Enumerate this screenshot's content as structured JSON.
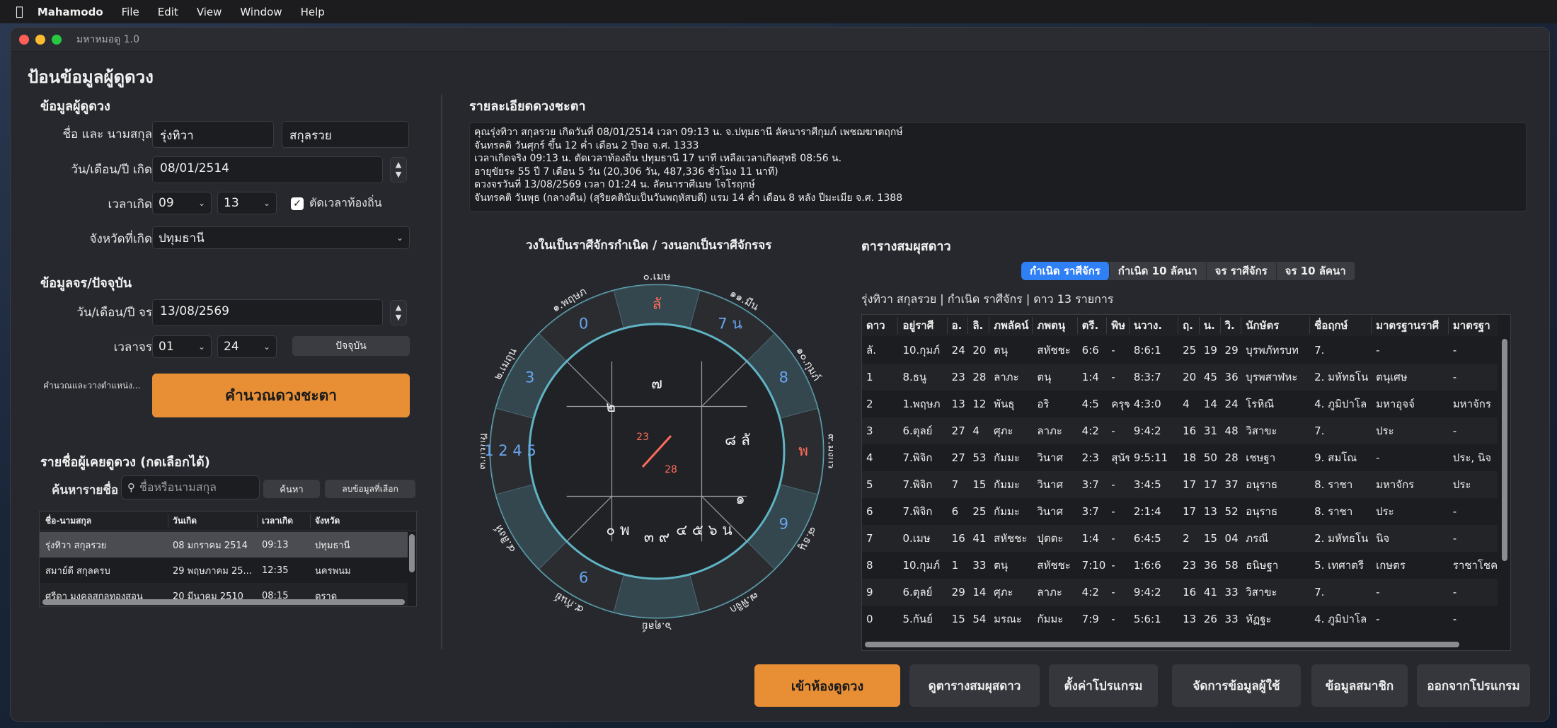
{
  "menubar": {
    "app": "Mahamodo",
    "items": [
      "File",
      "Edit",
      "View",
      "Window",
      "Help"
    ]
  },
  "window_title": "มหาหมอดู 1.0",
  "page_title": "ป้อนข้อมูลผู้ดูดวง",
  "person": {
    "section": "ข้อมูลผู้ดูดวง",
    "name_label": "ชื่อ และ นามสกุล",
    "first_name": "รุ่งทิวา",
    "last_name": "สกุลรวย",
    "dob_label": "วัน/เดือน/ปี เกิด",
    "dob": "08/01/2514",
    "time_label": "เวลาเกิด",
    "hour": "09",
    "minute": "13",
    "local_time_label": "ตัดเวลาท้องถิ่น",
    "province_label": "จังหวัดที่เกิด",
    "province": "ปทุมธานี"
  },
  "transit": {
    "section": "ข้อมูลจร/ปัจจุบัน",
    "date_label": "วัน/เดือน/ปี จร",
    "date": "13/08/2569",
    "time_label": "เวลาจร",
    "hour": "01",
    "minute": "24",
    "now_button": "ปัจจุบัน",
    "calc_status": "คำนวณและวางตำแหน่ง...",
    "calc_button": "คำนวณดวงชะตา"
  },
  "history": {
    "title": "รายชื่อผู้เคยดูดวง (กดเลือกได้)",
    "search_label": "ค้นหารายชื่อ :",
    "search_placeholder": "ชื่อหรือนามสกุล",
    "search_button": "ค้นหา",
    "delete_button": "ลบข้อมูลที่เลือก",
    "columns": [
      "ชื่อ-นามสกุล",
      "วันเกิด",
      "เวลาเกิด",
      "จังหวัด"
    ],
    "rows": [
      [
        "รุ่งทิวา สกุลรวย",
        "08 มกราคม 2514",
        "09:13",
        "ปทุมธานี"
      ],
      [
        "สมาย์ดี สกุลครบ",
        "29 พฤษภาคม 25...",
        "12:35",
        "นครพนม"
      ],
      [
        "ศรีดา มงคลสกุลทองสอน",
        "20 มีนาคม 2510",
        "08:15",
        "ตราด"
      ]
    ]
  },
  "details": {
    "title": "รายละเอียดดวงชะตา",
    "lines": [
      "คุณรุ่งทิวา สกุลรวย เกิดวันที่ 08/01/2514 เวลา 09:13 น. จ.ปทุมธานี ลัคนาราศีกุมภ์ เพชฌฆาตฤกษ์",
      "จันทรคติ วันศุกร์ ขึ้น 12 ค่ำ เดือน 2 ปีจอ จ.ศ. 1333",
      "เวลาเกิดจริง 09:13 น. ตัดเวลาท้องถิ่น ปทุมธานี 17 นาที เหลือเวลาเกิดสุทธิ 08:56 น.",
      "อายุขัยระ 55 ปี 7 เดือน 5 วัน (20,306 วัน, 487,336 ชั่วโมง 11 นาที)",
      "ดวงจรวันที่ 13/08/2569 เวลา 01:24 น. ลัคนาราศีเมษ โจโรฤกษ์",
      "จันทรคติ วันพุธ (กลางคืน) (สุริยคตินับเป็นวันพฤหัสบดี) แรม 14 ค่ำ เดือน 8 หลัง ปีมะเมีย จ.ศ. 1388"
    ]
  },
  "wheel": {
    "title": "วงในเป็นราศีจักรกำเนิด / วงนอกเป็นราศีจักรจร",
    "signs": [
      "๐.เมษ",
      "๑.พฤษภ",
      "๒.เมถุน",
      "๓.กรกฎ",
      "๔.สิงห์",
      "๕.กันย์",
      "๖.ตุลย์",
      "๗.พิจิก",
      "๘.ธนู",
      "๙.มังกร",
      "๑๐.กุมภ์",
      "๑๑.มีน"
    ],
    "outer_marks": [
      {
        "text": "ลั",
        "color": "#ff6b5b"
      },
      {
        "text": "0",
        "color": "#6aa5f0"
      },
      {
        "text": "3",
        "color": "#6aa5f0"
      },
      {
        "text": "1 2 4 5",
        "color": "#6aa5f0"
      },
      {
        "text": "",
        "color": "#6aa5f0"
      },
      {
        "text": "6",
        "color": "#6aa5f0"
      },
      {
        "text": "",
        "color": "#6aa5f0"
      },
      {
        "text": "",
        "color": "#6aa5f0"
      },
      {
        "text": "9",
        "color": "#6aa5f0"
      },
      {
        "text": "พ",
        "color": "#ff6b5b"
      },
      {
        "text": "8",
        "color": "#6aa5f0"
      },
      {
        "text": "7 น",
        "color": "#6aa5f0"
      }
    ],
    "inner_marks": [
      {
        "text": "๗"
      },
      {
        "text": "๒"
      },
      {
        "text": ""
      },
      {
        "text": ""
      },
      {
        "text": "๐ พ"
      },
      {
        "text": "๓ ๙"
      },
      {
        "text": "๔ ๕ ๖ น"
      },
      {
        "text": "๑"
      },
      {
        "text": ""
      },
      {
        "text": "๘ ลั"
      }
    ],
    "center": {
      "a": "23",
      "b": "28"
    }
  },
  "planet_table": {
    "title": "ตารางสมผุสดาว",
    "tabs": [
      "กำเนิด ราศีจักร",
      "กำเนิด 10 ลัคนา",
      "จร ราศีจักร",
      "จร 10 ลัคนา"
    ],
    "active_tab": 0,
    "summary": "รุ่งทิวา สกุลรวย  |  กำเนิด ราศีจักร  |  ดาว 13 รายการ",
    "columns": [
      "ดาว",
      "อยู่ราศี",
      "อ.",
      "ลิ.",
      "ภพลัคน์",
      "ภพตนุ",
      "ตรี.",
      "พิษ",
      "นวาง.",
      "ฤ.",
      "น.",
      "วิ.",
      "นักษัตร",
      "ชื่อฤกษ์",
      "มาตรฐานราศี",
      "มาตรฐา"
    ],
    "rows": [
      [
        "ลั.",
        "10.กุมภ์",
        "24",
        "20",
        "ตนุ",
        "สหัชชะ",
        "6:6",
        "-",
        "8:6:1",
        "25",
        "19",
        "29",
        "บุรพภัทรบท",
        "7.",
        "-",
        "-"
      ],
      [
        "1",
        "8.ธนู",
        "23",
        "28",
        "ลาภะ",
        "ตนุ",
        "1:4",
        "-",
        "8:3:7",
        "20",
        "45",
        "36",
        "บุรพสาฬหะ",
        "2. มหัทธโน",
        "ตนุเศษ",
        "-"
      ],
      [
        "2",
        "1.พฤษภ",
        "13",
        "12",
        "พันธุ",
        "อริ",
        "4:5",
        "ครุฑ",
        "4:3:0",
        "4",
        "14",
        "24",
        "โรหิณี",
        "4. ภูมิปาโล",
        "มหาอุจจ์",
        "มหาจักร"
      ],
      [
        "3",
        "6.ตุลย์",
        "27",
        "4",
        "ศุภะ",
        "ลาภะ",
        "4:2",
        "-",
        "9:4:2",
        "16",
        "31",
        "48",
        "วิสาขะ",
        "7.",
        "ประ",
        "-"
      ],
      [
        "4",
        "7.พิจิก",
        "27",
        "53",
        "กัมมะ",
        "วินาศ",
        "2:3",
        "สุนัข",
        "9:5:11",
        "18",
        "50",
        "28",
        "เชษฐา",
        "9. สมโณ",
        "-",
        "ประ, นิจ"
      ],
      [
        "5",
        "7.พิจิก",
        "7",
        "15",
        "กัมมะ",
        "วินาศ",
        "3:7",
        "-",
        "3:4:5",
        "17",
        "17",
        "37",
        "อนุราธ",
        "8. ราชา",
        "มหาจักร",
        "ประ"
      ],
      [
        "6",
        "7.พิจิก",
        "6",
        "25",
        "กัมมะ",
        "วินาศ",
        "3:7",
        "-",
        "2:1:4",
        "17",
        "13",
        "52",
        "อนุราธ",
        "8. ราชา",
        "ประ",
        "-"
      ],
      [
        "7",
        "0.เมษ",
        "16",
        "41",
        "สหัชชะ",
        "ปุตตะ",
        "1:4",
        "-",
        "6:4:5",
        "2",
        "15",
        "04",
        "ภรณี",
        "2. มหัทธโน",
        "นิจ",
        "-"
      ],
      [
        "8",
        "10.กุมภ์",
        "1",
        "33",
        "ตนุ",
        "สหัชชะ",
        "7:10",
        "-",
        "1:6:6",
        "23",
        "36",
        "58",
        "ธนิษฐา",
        "5. เทศาตรี",
        "เกษตร",
        "ราชาโชค"
      ],
      [
        "9",
        "6.ตุลย์",
        "29",
        "14",
        "ศุภะ",
        "ลาภะ",
        "4:2",
        "-",
        "9:4:2",
        "16",
        "41",
        "33",
        "วิสาขะ",
        "7.",
        "-",
        "-"
      ],
      [
        "0",
        "5.กันย์",
        "15",
        "54",
        "มรณะ",
        "กัมมะ",
        "7:9",
        "-",
        "5:6:1",
        "13",
        "26",
        "33",
        "หัฏฐะ",
        "4. ภูมิปาโล",
        "-",
        "-"
      ]
    ]
  },
  "bottom_buttons": {
    "enter": "เข้าห้องดูดวง",
    "view_table": "ดูตารางสมผุสดาว",
    "settings": "ตั้งค่าโปรแกรม",
    "manage_users": "จัดการข้อมูลผู้ใช้",
    "members": "ข้อมูลสมาชิก",
    "exit": "ออกจากโปรแกรม"
  },
  "colors": {
    "accent_orange": "#e88f35",
    "accent_blue": "#2f7ff5",
    "wheel_ring": "#5fb4c4",
    "red_mark": "#ff6b5b",
    "blue_mark": "#6aa5f0"
  }
}
